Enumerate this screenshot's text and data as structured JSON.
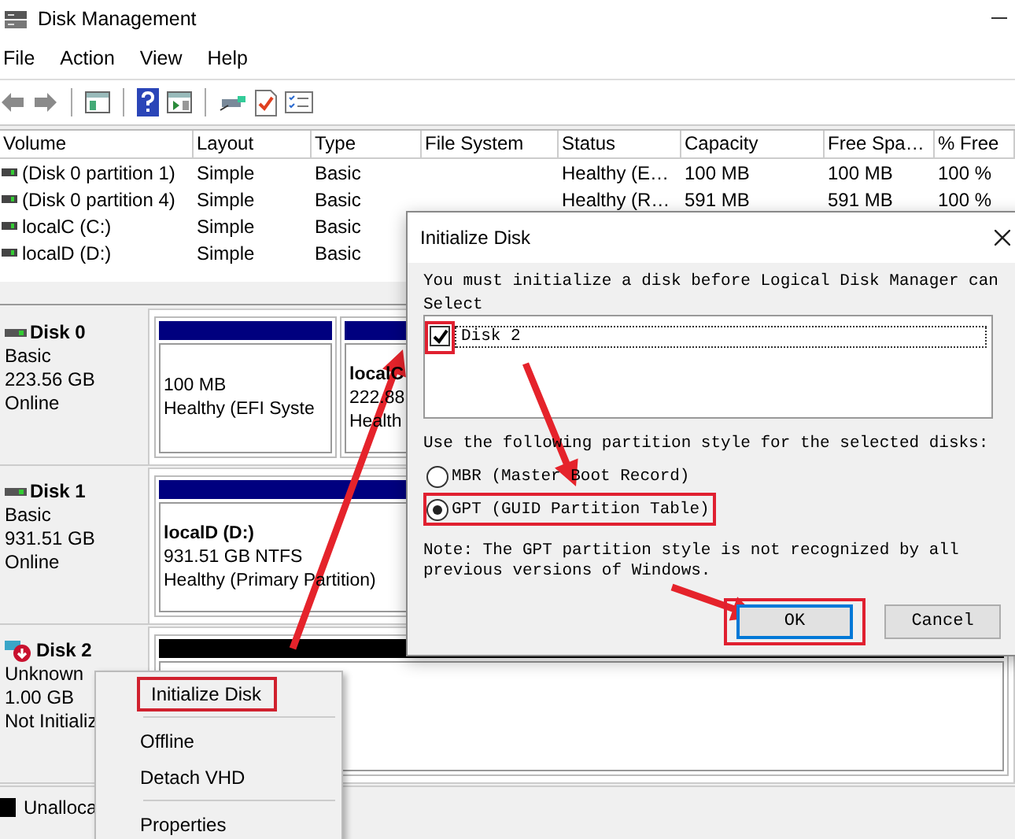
{
  "window": {
    "title": "Disk Management"
  },
  "menu": [
    "File",
    "Action",
    "View",
    "Help"
  ],
  "volume_table": {
    "columns": [
      "Volume",
      "Layout",
      "Type",
      "File System",
      "Status",
      "Capacity",
      "Free Spa…",
      "% Free"
    ],
    "rows": [
      {
        "volume": "(Disk 0 partition 1)",
        "layout": "Simple",
        "type": "Basic",
        "status": "Healthy (E…",
        "capacity": "100 MB",
        "free_space": "100 MB",
        "percent_free": "100 %"
      },
      {
        "volume": "(Disk 0 partition 4)",
        "layout": "Simple",
        "type": "Basic",
        "status": "Healthy (R…",
        "capacity": "591 MB",
        "free_space": "591 MB",
        "percent_free": "100 %"
      },
      {
        "volume": "localC (C:)",
        "layout": "Simple",
        "type": "Basic"
      },
      {
        "volume": "localD (D:)",
        "layout": "Simple",
        "type": "Basic"
      }
    ]
  },
  "disks": [
    {
      "name": "Disk 0",
      "kind": "online",
      "type": "Basic",
      "size": "223.56 GB",
      "status": "Online",
      "partitions": [
        {
          "kind": "primary",
          "lines": [
            "100 MB",
            "Healthy (EFI Syste"
          ]
        },
        {
          "kind": "primary",
          "title": "localC",
          "lines": [
            "222.88",
            "Health"
          ]
        }
      ]
    },
    {
      "name": "Disk 1",
      "kind": "online",
      "type": "Basic",
      "size": "931.51 GB",
      "status": "Online",
      "partitions": [
        {
          "kind": "primary",
          "title": "localD  (D:)",
          "lines": [
            "931.51 GB NTFS",
            "Healthy (Primary Partition)"
          ]
        }
      ]
    },
    {
      "name": "Disk 2",
      "kind": "not_initialized",
      "type": "Unknown",
      "size": "1.00 GB",
      "status": "Not Initializ",
      "partitions": [
        {
          "kind": "unallocated"
        }
      ]
    }
  ],
  "legend": [
    {
      "label": "Unalloca",
      "color": "#000000"
    }
  ],
  "context_menu": {
    "items": [
      {
        "label": "Initialize Disk",
        "highlighted": true,
        "separator_after": true
      },
      {
        "label": "Offline",
        "highlighted": false,
        "separator_after": false
      },
      {
        "label": "Detach VHD",
        "highlighted": false,
        "separator_after": true
      },
      {
        "label": "Properties",
        "highlighted": false,
        "separator_after": false
      }
    ]
  },
  "dialog": {
    "title": "Initialize Disk",
    "message": "You must initialize a disk before Logical Disk Manager can",
    "select_label": "Select",
    "disks": [
      {
        "label": "Disk 2",
        "checked": true,
        "highlighted": true
      }
    ],
    "style_label": "Use the following partition style for the selected disks:",
    "options": [
      {
        "label": "MBR (Master Boot Record)",
        "selected": false,
        "highlighted": false
      },
      {
        "label": "GPT (GUID Partition Table)",
        "selected": true,
        "highlighted": true
      }
    ],
    "note": "Note: The GPT partition style is not recognized by all previous versions of Windows.",
    "buttons": [
      {
        "label": "OK",
        "kind": "default",
        "highlighted": true
      },
      {
        "label": "Cancel",
        "kind": "normal",
        "highlighted": false
      }
    ]
  }
}
